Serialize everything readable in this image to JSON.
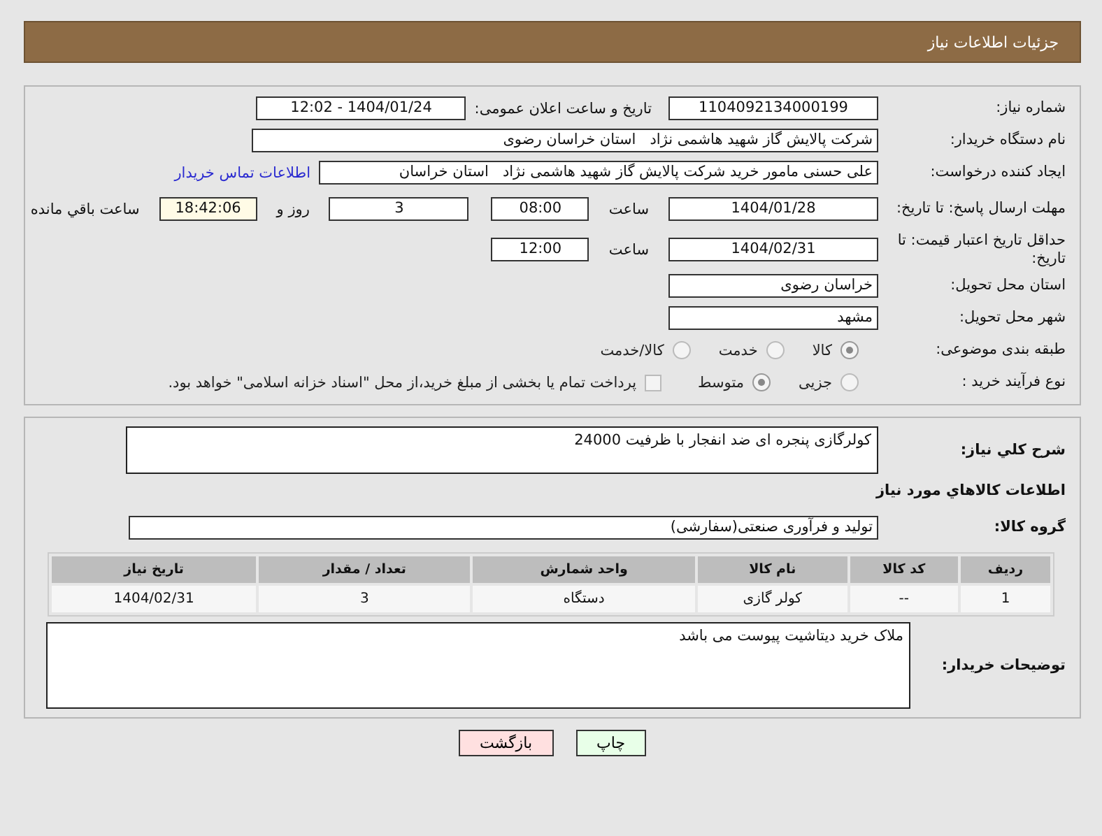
{
  "header": {
    "title": "جزئیات اطلاعات نیاز"
  },
  "need_number": {
    "label": "شماره نیاز:",
    "value": "1104092134000199"
  },
  "announce": {
    "label": "تاریخ و ساعت اعلان عمومی:",
    "value": "1404/01/24 - 12:02"
  },
  "buyer_org": {
    "label": "نام دستگاه خریدار:",
    "value": "شرکت پالایش گاز شهید هاشمی نژاد   استان خراسان رضوی"
  },
  "creator": {
    "label": "ایجاد کننده درخواست:",
    "value": "علی حسنی مامور خرید شرکت پالایش گاز شهید هاشمی نژاد   استان خراسان",
    "link": "اطلاعات تماس خریدار"
  },
  "reply_deadline": {
    "label": "مهلت ارسال پاسخ: تا تاریخ:",
    "date": "1404/01/28",
    "time_label": "ساعت",
    "time": "08:00",
    "days": "3",
    "days_label": "روز و",
    "remaining": "18:42:06",
    "remaining_label": "ساعت باقي مانده"
  },
  "price_validity": {
    "label": "حداقل تاریخ اعتبار قیمت: تا تاریخ:",
    "date": "1404/02/31",
    "time_label": "ساعت",
    "time": "12:00"
  },
  "province": {
    "label": "استان محل تحویل:",
    "value": "خراسان رضوی"
  },
  "city": {
    "label": "شهر محل تحویل:",
    "value": "مشهد"
  },
  "category": {
    "label": "طبقه بندی موضوعی:",
    "options": [
      {
        "label": "کالا",
        "selected": true
      },
      {
        "label": "خدمت",
        "selected": false
      },
      {
        "label": "کالا/خدمت",
        "selected": false
      }
    ]
  },
  "process": {
    "label": "نوع فرآیند خرید :",
    "options": [
      {
        "label": "جزیی",
        "selected": false
      },
      {
        "label": "متوسط",
        "selected": true
      }
    ],
    "treasury": {
      "label": "پرداخت تمام یا بخشی از مبلغ خرید،از محل \"اسناد خزانه اسلامی\" خواهد بود.",
      "checked": false
    }
  },
  "description": {
    "label": "شرح کلي نیاز:",
    "value": "کولرگازی پنجره ای ضد انفجار با ظرفیت 24000"
  },
  "goods_heading": "اطلاعات کالاهاي مورد نیاز",
  "goods_group": {
    "label": "گروه کالا:",
    "value": "تولید و فرآوری صنعتی(سفارشی)"
  },
  "table": {
    "columns": [
      "ردیف",
      "کد کالا",
      "نام کالا",
      "واحد شمارش",
      "تعداد / مقدار",
      "تاریخ نیاز"
    ],
    "rows": [
      [
        "1",
        "--",
        "کولر گازی",
        "دستگاه",
        "3",
        "1404/02/31"
      ]
    ]
  },
  "buyer_notes": {
    "label": "توضیحات خریدار:",
    "value": "ملاک خرید دیتاشیت پیوست می باشد"
  },
  "buttons": [
    {
      "label": "چاپ",
      "kind": "print"
    },
    {
      "label": "بازگشت",
      "kind": "back"
    }
  ]
}
